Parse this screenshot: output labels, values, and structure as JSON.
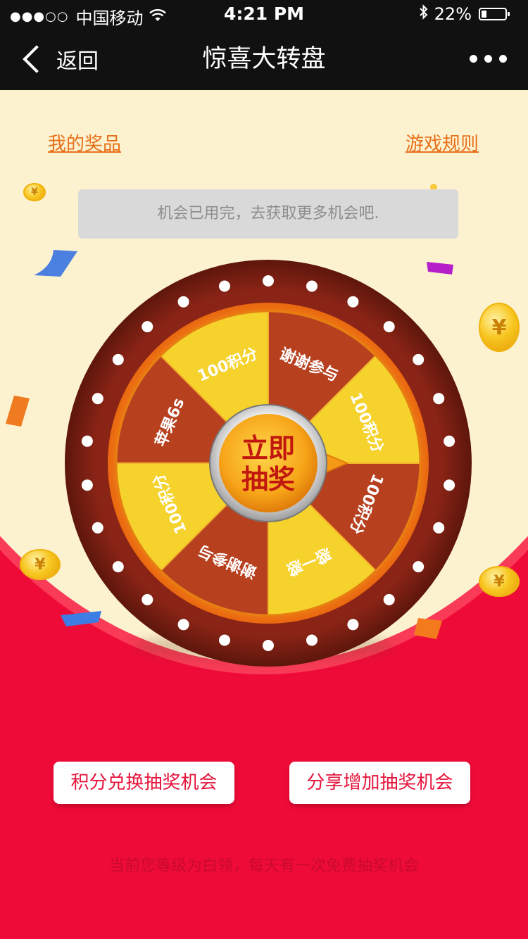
{
  "status_bar": {
    "signal": "●●●○○",
    "carrier": "中国移动",
    "time": "4:21 PM",
    "battery": "22%",
    "battery_level": 0.22
  },
  "nav": {
    "back_label": "返回",
    "title": "惊喜大转盘"
  },
  "links": {
    "my_prizes": "我的奖品",
    "game_rules": "游戏规则"
  },
  "notice": "机会已用完，去获取更多机会吧.",
  "wheel": {
    "center_line1": "立即",
    "center_line2": "抽奖",
    "segments": [
      {
        "label": "谢谢参与",
        "color": "#b7401f"
      },
      {
        "label": "100积分",
        "color": "#f5d22c"
      },
      {
        "label": "100积分",
        "color": "#b7401f"
      },
      {
        "label": "惑一惑",
        "color": "#f5d22c"
      },
      {
        "label": "谢谢参与",
        "color": "#b7401f"
      },
      {
        "label": "100积分",
        "color": "#f5d22c"
      },
      {
        "label": "苹果6s",
        "color": "#b7401f"
      },
      {
        "label": "100积分",
        "color": "#f5d22c"
      }
    ]
  },
  "buttons": {
    "exchange": "积分兑换抽奖机会",
    "share": "分享增加抽奖机会"
  },
  "footnote": "当前您等级为白领，每天有一次免费抽奖机会",
  "colors": {
    "cream_bg": "#fdf2cf",
    "red_bg": "#ef0b38",
    "link": "#e7701b",
    "wheel_rim": "#7a1f14"
  }
}
